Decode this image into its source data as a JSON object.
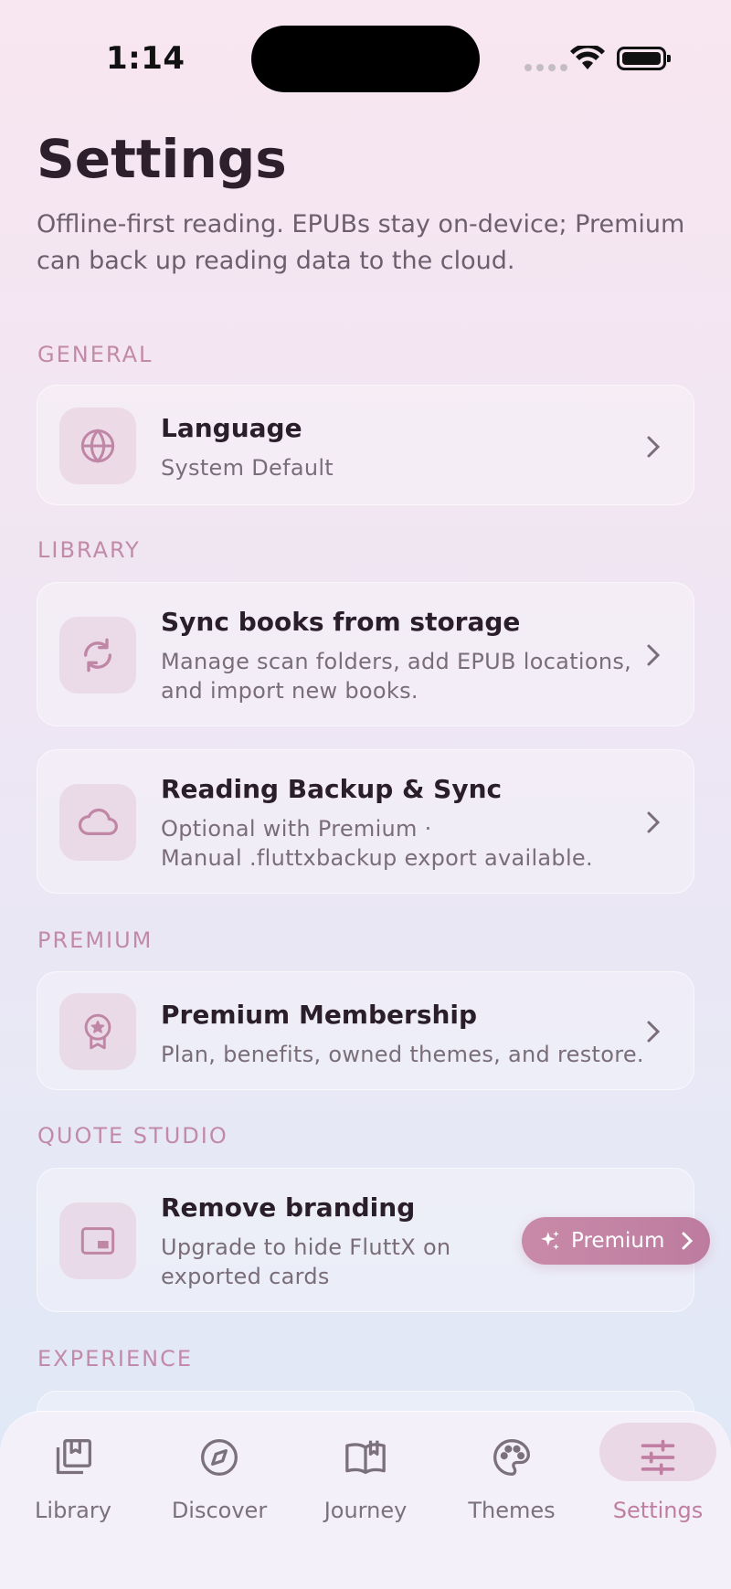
{
  "status_bar": {
    "time": "1:14"
  },
  "header": {
    "title": "Settings",
    "subtitle": "Offline-first reading. EPUBs stay on-device; Premium can back up reading data to the cloud."
  },
  "sections": {
    "general": "GENERAL",
    "library": "LIBRARY",
    "premium": "PREMIUM",
    "quote_studio": "QUOTE STUDIO",
    "experience": "EXPERIENCE"
  },
  "items": {
    "language": {
      "title": "Language",
      "subtitle": "System Default",
      "icon": "globe-icon"
    },
    "sync_books": {
      "title": "Sync books from storage",
      "subtitle_1": "Manage scan folders, add EPUB locations,",
      "subtitle_2": "and import new books.",
      "icon": "sync-icon"
    },
    "backup": {
      "title": "Reading Backup & Sync",
      "subtitle_1": "Optional with Premium ·",
      "subtitle_2": "Manual .fluttxbackup export available.",
      "icon": "cloud-icon"
    },
    "membership": {
      "title": "Premium Membership",
      "subtitle": "Plan, benefits, owned themes, and restore.",
      "icon": "award-icon"
    },
    "branding": {
      "title": "Remove branding",
      "subtitle_1": "Upgrade to hide FluttX on",
      "subtitle_2": "exported cards",
      "icon": "picture-in-picture-icon",
      "badge": "Premium"
    }
  },
  "tab_bar": {
    "tabs": [
      {
        "label": "Library",
        "icon": "library-icon"
      },
      {
        "label": "Discover",
        "icon": "compass-icon"
      },
      {
        "label": "Journey",
        "icon": "book-open-icon"
      },
      {
        "label": "Themes",
        "icon": "palette-icon"
      },
      {
        "label": "Settings",
        "icon": "sliders-icon",
        "active": true
      }
    ]
  },
  "colors": {
    "accent": "#c07fa2",
    "section_label": "#c28aa9",
    "icon": "#bf86a6"
  }
}
